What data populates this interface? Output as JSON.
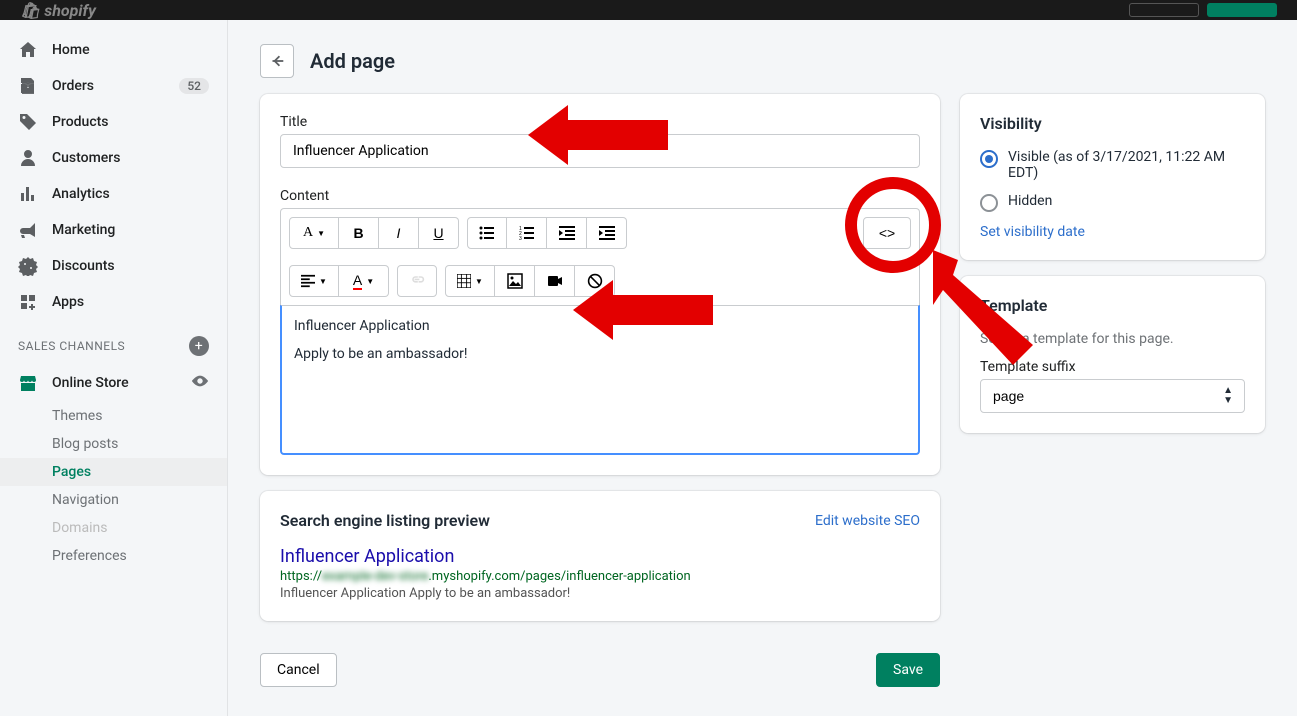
{
  "topbar": {
    "brand": "shopify"
  },
  "sidebar": {
    "home": "Home",
    "orders": "Orders",
    "orders_badge": "52",
    "products": "Products",
    "customers": "Customers",
    "analytics": "Analytics",
    "marketing": "Marketing",
    "discounts": "Discounts",
    "apps": "Apps",
    "section": "SALES CHANNELS",
    "online_store": "Online Store",
    "subs": {
      "themes": "Themes",
      "blog_posts": "Blog posts",
      "pages": "Pages",
      "navigation": "Navigation",
      "domains": "Domains",
      "preferences": "Preferences"
    }
  },
  "page": {
    "title": "Add page",
    "title_field_label": "Title",
    "title_value": "Influencer Application",
    "content_label": "Content",
    "content_line1": "Influencer Application",
    "content_line2": "Apply to be an ambassador!",
    "cancel": "Cancel",
    "save": "Save"
  },
  "visibility": {
    "heading": "Visibility",
    "visible_label": "Visible (as of 3/17/2021, 11:22 AM EDT)",
    "hidden_label": "Hidden",
    "set_date": "Set visibility date"
  },
  "template": {
    "heading": "Template",
    "help": "Select a template for this page.",
    "suffix_label": "Template suffix",
    "value": "page"
  },
  "seo": {
    "heading": "Search engine listing preview",
    "edit": "Edit website SEO",
    "title": "Influencer Application",
    "url_prefix": "https://",
    "url_blurred": "example-dev-store",
    "url_rest": ".myshopify.com/pages/influencer-application",
    "desc": "Influencer Application Apply to be an ambassador!"
  }
}
